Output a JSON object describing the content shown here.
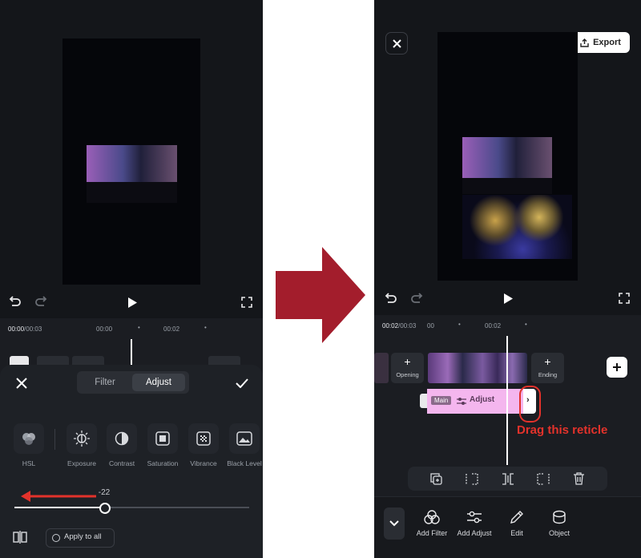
{
  "left": {
    "ruler": {
      "time": "00:00",
      "total": "/00:03",
      "mark1": "00:00",
      "mark2": "00:02"
    },
    "tabs": {
      "filter": "Filter",
      "adjust": "Adjust"
    },
    "tools": [
      {
        "label": "HSL"
      },
      {
        "label": "Exposure"
      },
      {
        "label": "Contrast"
      },
      {
        "label": "Saturation"
      },
      {
        "label": "Vibrance"
      },
      {
        "label": "Black Level"
      }
    ],
    "slider": {
      "value_label": "-22",
      "value": -22
    },
    "apply_all_label": "Apply to all"
  },
  "right": {
    "export_label": "Export",
    "ruler": {
      "time": "00:02",
      "total": "/00:03",
      "mark1": "00",
      "mark2": "00:02"
    },
    "opening_label": "Opening",
    "ending_label": "Ending",
    "track": {
      "badge": "Main",
      "label": "Adjust"
    },
    "annotation": "Drag this reticle",
    "bottom": [
      {
        "label": "Add Filter"
      },
      {
        "label": "Add Adjust"
      },
      {
        "label": "Edit"
      },
      {
        "label": "Object"
      }
    ]
  },
  "colors": {
    "arrow": "#a31d2c",
    "annotation": "#e3322b",
    "accent_pink": "#f4b6ee",
    "panel": "#14161a"
  }
}
